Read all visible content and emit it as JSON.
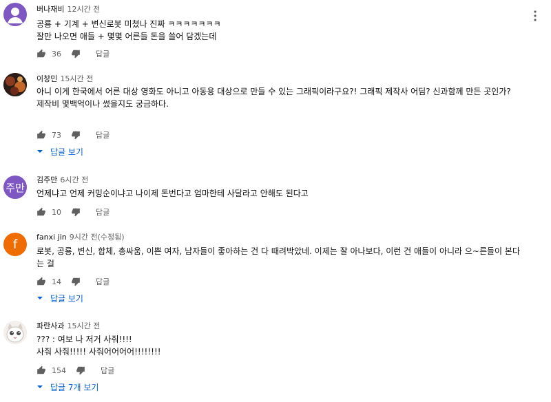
{
  "colors": {
    "link": "#065fd4",
    "meta": "#606060"
  },
  "reply_label": "답글",
  "comments": [
    {
      "author": "버나재비",
      "time": "12시간 전",
      "text": "공룡 + 기계 + 변신로봇 미쳤나 진짜 ㅋㅋㅋㅋㅋㅋㅋ\n잘만 나오면 애들 + 몇몇 어른들 돈을 쓸어 담겠는데",
      "likes": "36",
      "avatar_color": "#7e57c2",
      "avatar_kind": "person-icon"
    },
    {
      "author": "이창민",
      "time": "15시간 전",
      "text": "아니 이게 한국에서 어른 대상 영화도 아니고 아동용 대상으로 만들 수 있는 그래픽이라구요?! 그래픽 제작사 어딤? 신과함께 만든 곳인가?\n제작비 몇백억이나 썼을지도 궁금하다.",
      "likes": "73",
      "avatar_color": "#3b2a22",
      "avatar_kind": "photo",
      "replies": "답글 보기"
    },
    {
      "author": "김주만",
      "time": "6시간 전",
      "text": "언제냐고 언제 커밍순이냐고 나이제 돈번다고  엄마한테 사달라고 안해도 된다고",
      "likes": "10",
      "avatar_color": "#7e57c2",
      "avatar_text": "주만"
    },
    {
      "author": "fanxi jin",
      "time": "9시간 전(수정됨)",
      "text": "로봇, 공룡, 변신, 합체, 총싸움, 이쁜 여자, 남자들이 좋아하는 건 다 때려박았네. 이제는 잘 아나보다, 이런 건 애들이 아니라 으~른들이 본다는 걸",
      "likes": "14",
      "avatar_color": "#ef6c00",
      "avatar_text": "f",
      "replies": "답글 보기"
    },
    {
      "author": "파란사과",
      "time": "15시간 전",
      "text": "??? : 여보 나 저거 사줘!!!!\n사줘 사줘!!!!! 사줘어어어어!!!!!!!!",
      "likes": "154",
      "avatar_color": "#e8e4e0",
      "avatar_kind": "cat-photo",
      "replies": "답글 7개 보기"
    }
  ]
}
